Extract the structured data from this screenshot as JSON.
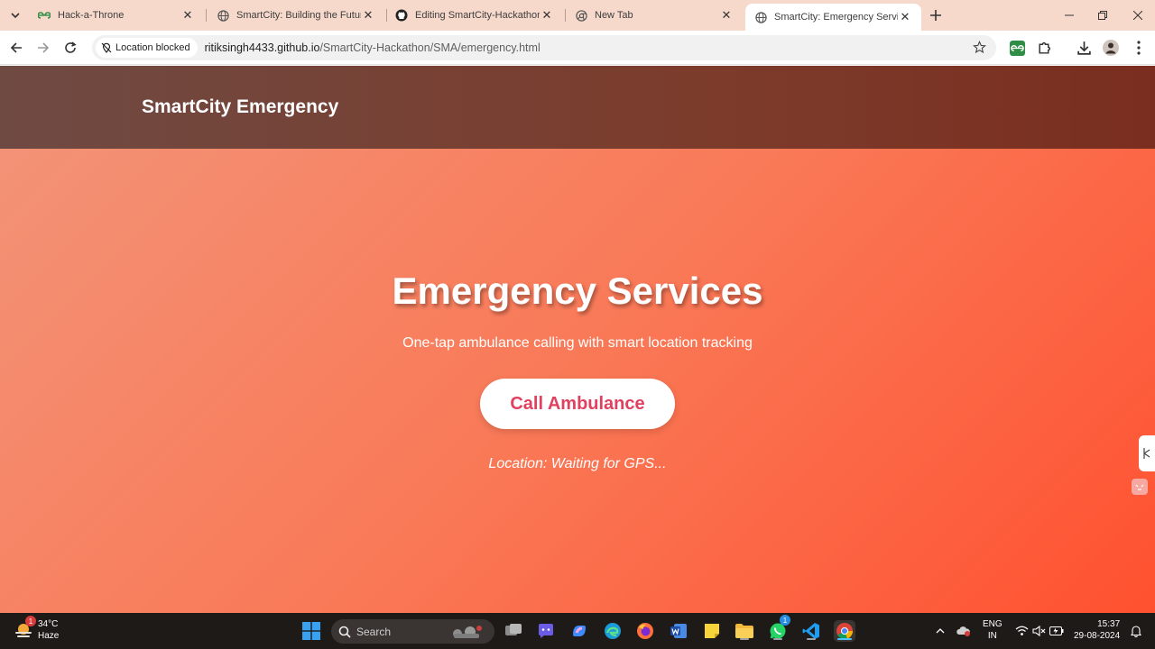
{
  "browser": {
    "tabs": [
      {
        "title": "Hack-a-Throne",
        "favicon": "gfg-icon"
      },
      {
        "title": "SmartCity: Building the Future",
        "favicon": "globe-icon"
      },
      {
        "title": "Editing SmartCity-Hackathon/R",
        "favicon": "github-icon"
      },
      {
        "title": "New Tab",
        "favicon": "chrome-icon"
      },
      {
        "title": "SmartCity: Emergency Services",
        "favicon": "globe-icon",
        "active": true
      }
    ],
    "location_chip": "Location blocked",
    "url_host": "ritiksingh4433.github.io",
    "url_path": "/SmartCity-Hackathon/SMA/emergency.html"
  },
  "page": {
    "brand": "SmartCity Emergency",
    "hero_title": "Emergency Services",
    "hero_subtitle": "One-tap ambulance calling with smart location tracking",
    "call_button": "Call Ambulance",
    "location_status": "Location: Waiting for GPS...",
    "colors": {
      "gradient_start": "#f2957a",
      "gradient_end": "#ff5130",
      "header": "#7a3c2e",
      "button_text": "#e1405f"
    }
  },
  "taskbar": {
    "weather_temp": "34°C",
    "weather_desc": "Haze",
    "weather_badge": "1",
    "search_placeholder": "Search",
    "whatsapp_badge": "1",
    "lang_top": "ENG",
    "lang_bottom": "IN",
    "time": "15:37",
    "date": "29-08-2024"
  }
}
